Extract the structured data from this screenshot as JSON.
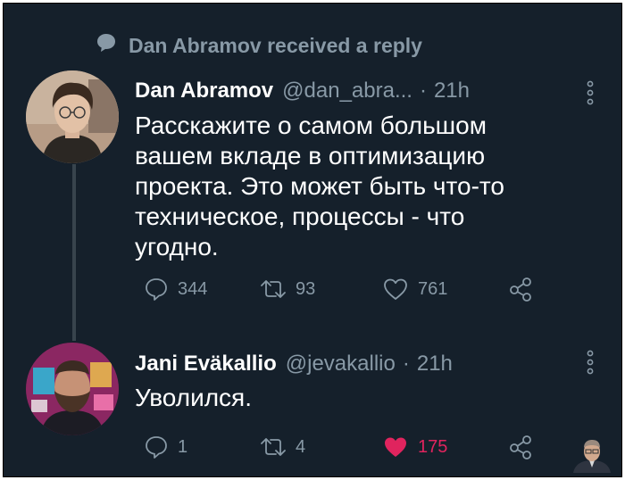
{
  "social_context": {
    "icon": "speech-bubble-icon",
    "text": "Dan Abramov received a reply"
  },
  "tweet1": {
    "author_name": "Dan Abramov",
    "handle": "@dan_abra...",
    "separator": "·",
    "time": "21h",
    "text_lines": [
      "Расскажите о самом большом",
      "вашем вкладе в оптимизацию",
      "проекта. Это может быть что-то",
      "техническое, процессы - что",
      "угодно."
    ],
    "replies": "344",
    "retweets": "93",
    "likes": "761"
  },
  "tweet2": {
    "author_name": "Jani Eväkallio",
    "handle": "@jevakallio",
    "separator": "·",
    "time": "21h",
    "text": "Уволился.",
    "replies": "1",
    "retweets": "4",
    "likes": "175",
    "liked": true
  },
  "colors": {
    "background": "#15202b",
    "secondary_text": "#8899a6",
    "like_red": "#e0245e",
    "thread_line": "#38444d"
  }
}
